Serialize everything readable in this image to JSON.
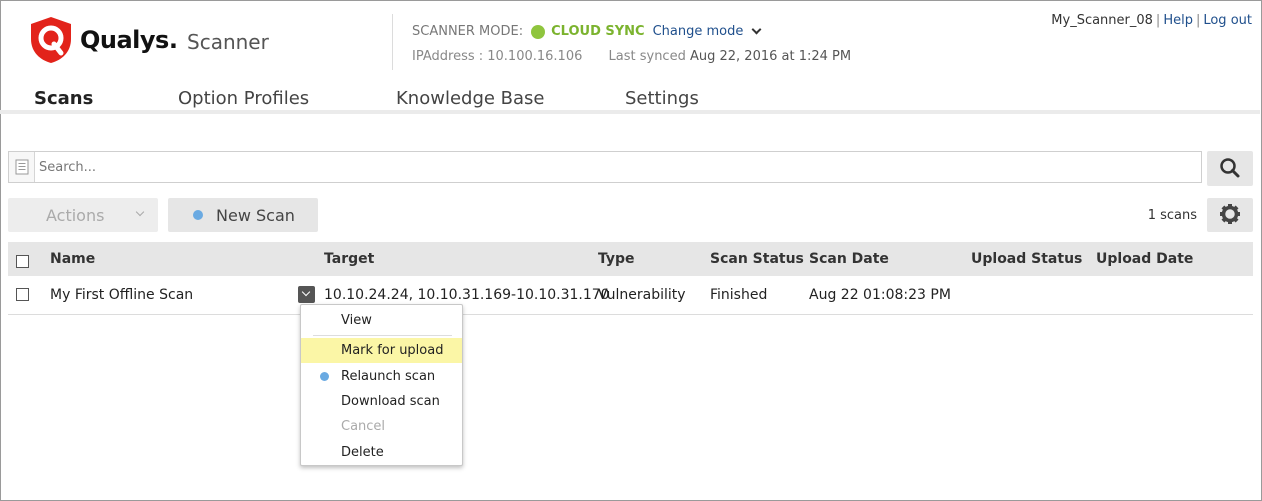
{
  "brand": {
    "name": "Qualys.",
    "product": "Scanner"
  },
  "header": {
    "mode_label": "SCANNER MODE:",
    "mode_value": "CLOUD SYNC",
    "mode_color": "#8fc53e",
    "change_mode": "Change mode",
    "ip_label": "IPAddress : 10.100.16.106",
    "last_synced_label": "Last synced",
    "last_synced_value": "Aug 22, 2016 at 1:24 PM"
  },
  "user": {
    "name": "My_Scanner_08",
    "help": "Help",
    "logout": "Log out"
  },
  "nav": {
    "scans": "Scans",
    "option_profiles": "Option Profiles",
    "knowledge_base": "Knowledge Base",
    "settings": "Settings",
    "active": "Scans"
  },
  "search": {
    "placeholder": "Search...",
    "value": ""
  },
  "toolbar": {
    "actions": "Actions",
    "new_scan": "New Scan",
    "count": "1 scans"
  },
  "table": {
    "columns": [
      "Name",
      "Target",
      "Type",
      "Scan Status",
      "Scan Date",
      "Upload Status",
      "Upload Date"
    ],
    "rows": [
      {
        "name": "My First Offline Scan",
        "target": "10.10.24.24, 10.10.31.169-10.10.31.170",
        "type": "Vulnerability",
        "status": "Finished",
        "date": "Aug 22 01:08:23 PM",
        "upload_status": "",
        "upload_date": ""
      }
    ]
  },
  "menu": {
    "items": [
      "View",
      "Mark for upload",
      "Relaunch scan",
      "Download scan",
      "Cancel",
      "Delete"
    ],
    "highlighted": "Mark for upload",
    "disabled": [
      "Cancel"
    ]
  },
  "colors": {
    "accent": "#1f4f8c",
    "brand_red": "#e2231a",
    "highlight": "#fbf6a6",
    "bullet": "#6aaae2"
  }
}
